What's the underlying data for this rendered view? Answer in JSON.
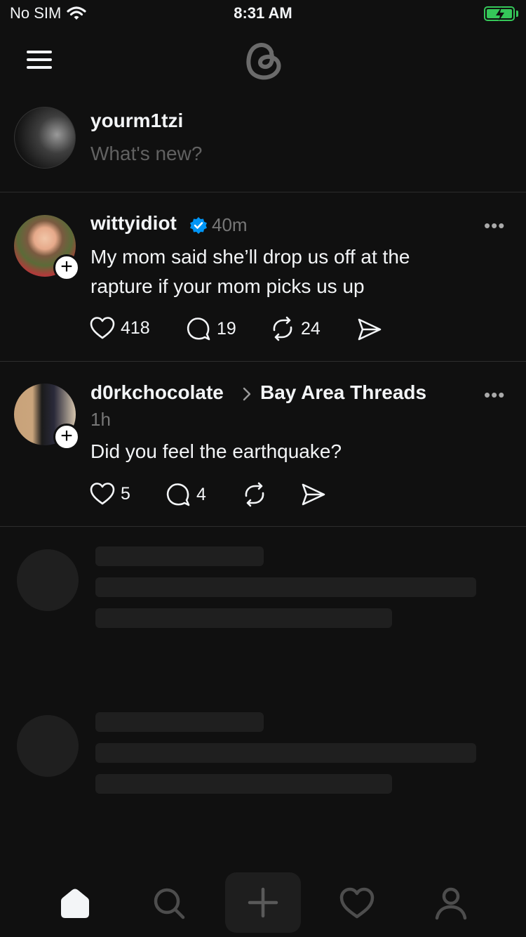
{
  "status_bar": {
    "carrier": "No SIM",
    "time": "8:31 AM"
  },
  "header": {
    "menu_icon": "hamburger-icon",
    "logo_icon": "threads-logo-icon"
  },
  "composer": {
    "username": "yourm1tzi",
    "placeholder": "What's new?"
  },
  "posts": [
    {
      "username": "wittyidiot",
      "verified": true,
      "time": "40m",
      "text_line1": "My mom said she’ll drop us off at the",
      "text_line2": "rapture if your mom picks us up",
      "likes": "418",
      "replies": "19",
      "reposts": "24"
    },
    {
      "username": "d0rkchocolate",
      "community": "Bay Area Threads",
      "time": "1h",
      "text_line1": "Did you feel the earthquake?",
      "likes": "5",
      "replies": "4"
    }
  ],
  "follow_symbol": "+",
  "more_symbol": "•••",
  "colors": {
    "background": "#101010",
    "text": "#f3f5f7",
    "muted": "#777777",
    "verified": "#0095f6",
    "battery": "#35c759"
  },
  "tab_bar": {
    "tabs": [
      "home-icon",
      "search-icon",
      "create-icon",
      "activity-heart-icon",
      "profile-icon"
    ]
  }
}
